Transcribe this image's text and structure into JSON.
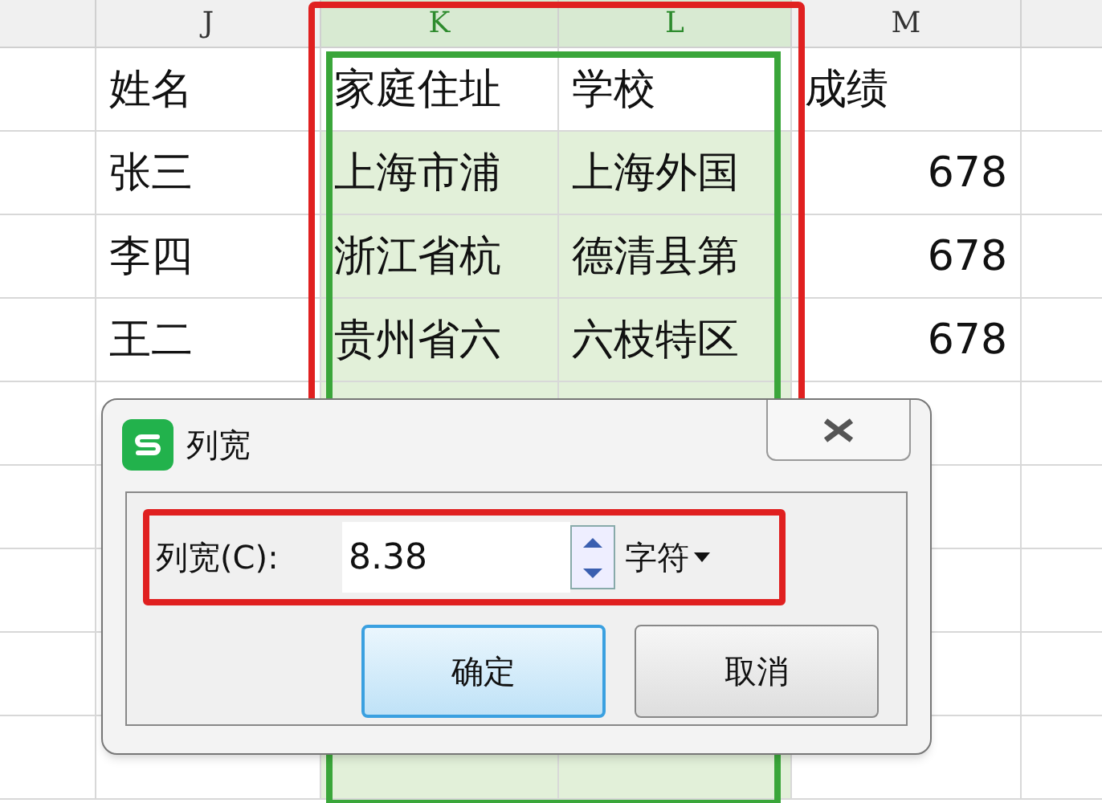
{
  "columns": [
    {
      "label": "J",
      "selected": false
    },
    {
      "label": "K",
      "selected": true
    },
    {
      "label": "L",
      "selected": true
    },
    {
      "label": "M",
      "selected": false
    }
  ],
  "rows": [
    [
      "姓名",
      "家庭住址",
      "学校",
      "成绩"
    ],
    [
      "张三",
      "上海市浦",
      "上海外国",
      "678"
    ],
    [
      "李四",
      "浙江省杭",
      "德清县第",
      "678"
    ],
    [
      "王二",
      "贵州省六",
      "六枝特区",
      "678"
    ]
  ],
  "dialog": {
    "title": "列宽",
    "field_label": "列宽(C):",
    "value": "8.38",
    "unit": "字符",
    "buttons": [
      {
        "label": "确定",
        "default": true
      },
      {
        "label": "取消",
        "default": false
      }
    ]
  }
}
